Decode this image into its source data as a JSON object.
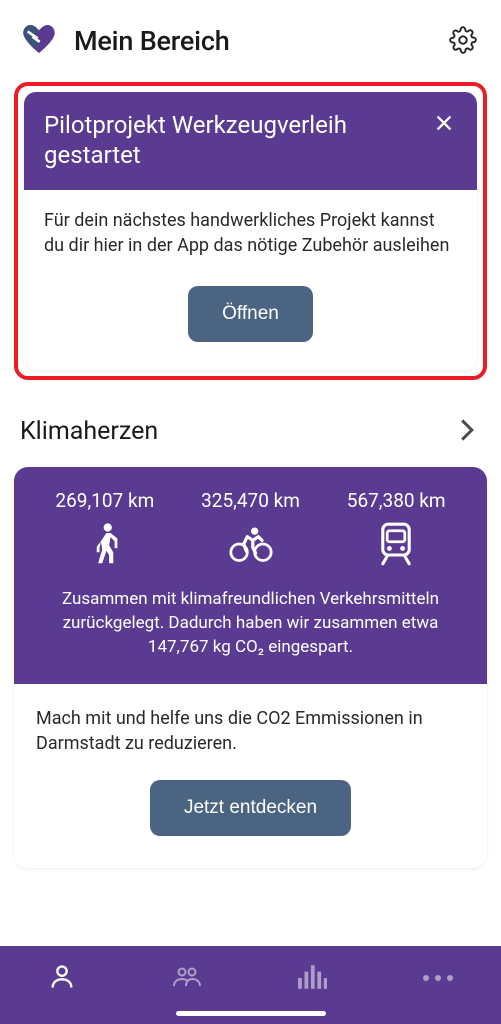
{
  "header": {
    "title": "Mein Bereich"
  },
  "notice": {
    "title": "Pilotprojekt Werkzeugverleih gestartet",
    "body": "Für dein nächstes handwerkliches Projekt kannst du dir hier in der App das nötige Zubehör ausleihen",
    "button": "Öffnen"
  },
  "section": {
    "title": "Klimaherzen"
  },
  "klima": {
    "stats": {
      "walk": "269,107 km",
      "bike": "325,470 km",
      "train": "567,380 km"
    },
    "description": "Zusammen mit klimafreundlichen Verkehrsmitteln zurückgelegt. Dadurch haben wir zusammen etwa 147,767 kg CO₂ eingespart.",
    "bottom_text": "Mach mit und helfe uns die CO2 Emmissionen in Darmstadt zu reduzieren.",
    "button": "Jetzt entdecken"
  }
}
